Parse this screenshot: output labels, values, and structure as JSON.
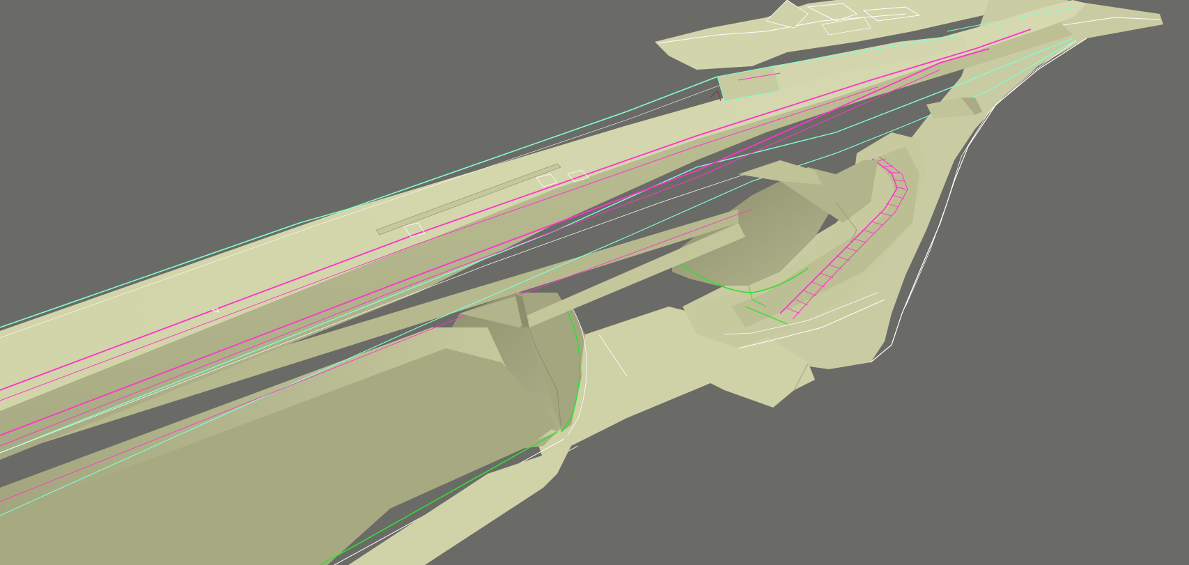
{
  "viewport": {
    "background_color": "#6a6b66",
    "surface_color": "#d4d6ad",
    "surface_shadow_color": "#9b9d7a",
    "edge_highlight_color": "#7fffd4",
    "rail_line_color": "#ff33cc",
    "green_edge_color": "#33dd33",
    "white_line_color": "#ffffff"
  }
}
